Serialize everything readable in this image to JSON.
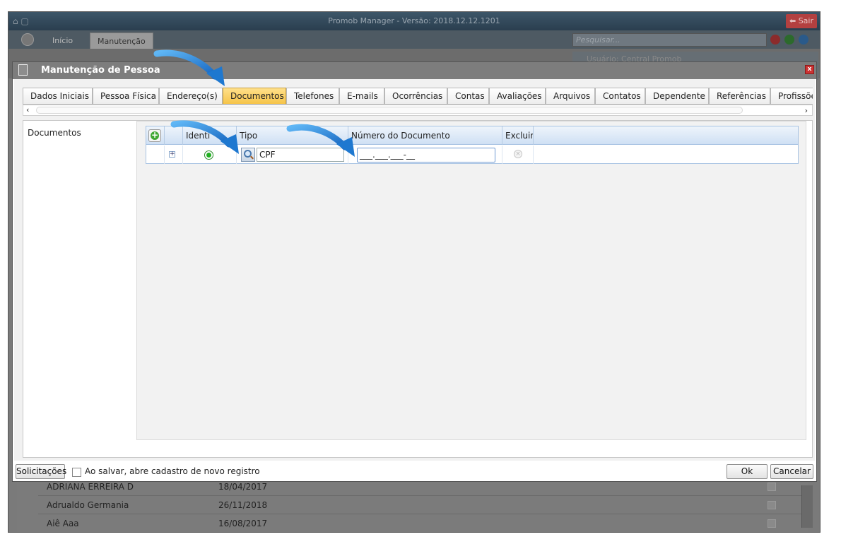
{
  "window": {
    "title": "Promob Manager - Versão: 2018.12.12.1201",
    "exit_label": "Sair"
  },
  "nav": {
    "tabs": [
      "Início",
      "Manutenção"
    ],
    "search_placeholder": "Pesquisar..."
  },
  "background_user": {
    "label": "Usuário:",
    "name": "Central Promob"
  },
  "background_rows": [
    {
      "name": "ADRIANA ERREIRA D",
      "date": "18/04/2017"
    },
    {
      "name": "Adrualdo Germania",
      "date": "26/11/2018"
    },
    {
      "name": "Aiê Aaa",
      "date": "16/08/2017"
    }
  ],
  "dialog": {
    "title": "Manutenção de Pessoa",
    "close_label": "x",
    "tabs": [
      "Dados Iniciais",
      "Pessoa Física",
      "Endereço(s)",
      "Documentos",
      "Telefones",
      "E-mails",
      "Ocorrências",
      "Contas",
      "Avaliações",
      "Arquivos",
      "Contatos",
      "Dependente",
      "Referências",
      "Profissões"
    ],
    "active_tab": "Documentos",
    "section_label": "Documentos",
    "grid": {
      "headers": [
        "Identi",
        "Tipo",
        "Número do Documento",
        "Excluir"
      ],
      "row": {
        "tipo": "CPF",
        "numero": "___.___.___-__"
      }
    },
    "footer": {
      "solicit_label": "Solicitações",
      "save_new_label": "Ao salvar, abre cadastro de novo registro",
      "ok_label": "Ok",
      "cancel_label": "Cancelar"
    }
  },
  "colors": {
    "active_tab": "#f5c347",
    "arrow": "#1e88e5",
    "grid_header": "#cfe0f4"
  }
}
